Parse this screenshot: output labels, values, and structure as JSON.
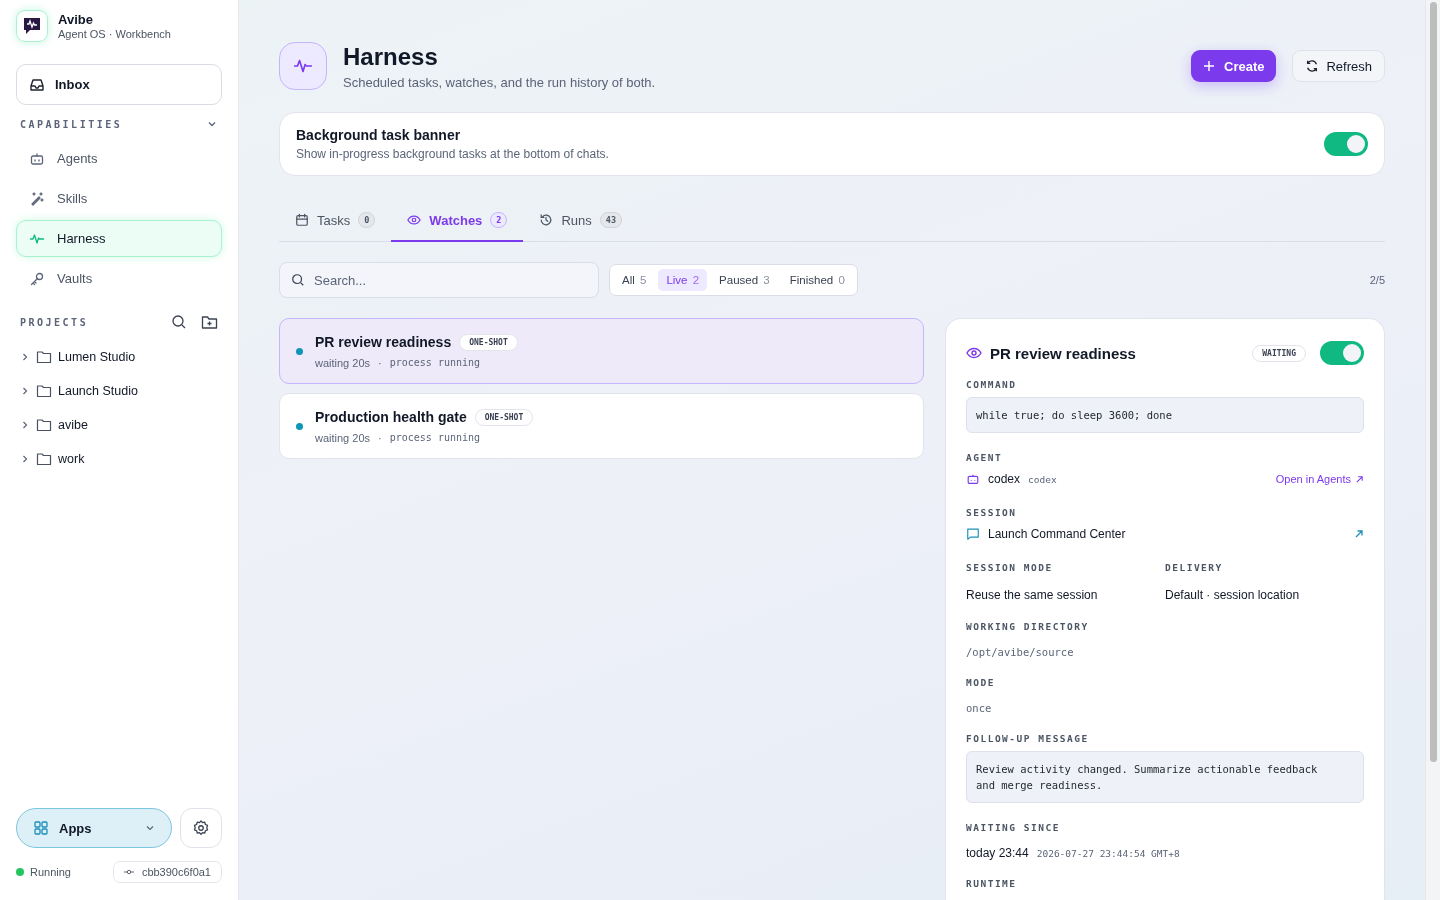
{
  "app": {
    "name": "Avibe",
    "subtitle": "Agent OS · Workbench"
  },
  "sidebar": {
    "inbox": {
      "label": "Inbox",
      "selected": false
    },
    "capabilities": {
      "label": "CAPABILITIES",
      "expanded": true,
      "items": [
        {
          "label": "Agents",
          "selected": false
        },
        {
          "label": "Skills",
          "selected": false
        },
        {
          "label": "Harness",
          "selected": true
        },
        {
          "label": "Vaults",
          "selected": false
        }
      ]
    },
    "projects": {
      "label": "PROJECTS",
      "items": [
        {
          "name": "Lumen Studio",
          "expanded": false
        },
        {
          "name": "Launch Studio",
          "expanded": false
        },
        {
          "name": "avibe",
          "expanded": false
        },
        {
          "name": "work",
          "expanded": false
        }
      ]
    },
    "apps_button": "Apps",
    "status": {
      "label": "Running",
      "color": "#22c55e"
    },
    "commit": "cbb390c6f0a1"
  },
  "header": {
    "title": "Harness",
    "subtitle": "Scheduled tasks, watches, and the run history of both.",
    "create": "Create",
    "refresh": "Refresh"
  },
  "banner": {
    "title": "Background task banner",
    "description": "Show in-progress background tasks at the bottom of chats.",
    "on": true
  },
  "tabs": [
    {
      "label": "Tasks",
      "count": "0",
      "selected": false
    },
    {
      "label": "Watches",
      "count": "2",
      "selected": true
    },
    {
      "label": "Runs",
      "count": "43",
      "selected": false
    }
  ],
  "search": {
    "placeholder": "Search..."
  },
  "filters": [
    {
      "label": "All",
      "count": "5",
      "selected": false
    },
    {
      "label": "Live",
      "count": "2",
      "selected": true
    },
    {
      "label": "Paused",
      "count": "3",
      "selected": false
    },
    {
      "label": "Finished",
      "count": "0",
      "selected": false
    }
  ],
  "pager": "2/5",
  "watches": [
    {
      "name": "PR review readiness",
      "badge": "ONE-SHOT",
      "status": "waiting 20s",
      "separator": "·",
      "detail": "process running",
      "selected": true
    },
    {
      "name": "Production health gate",
      "badge": "ONE-SHOT",
      "status": "waiting 20s",
      "separator": "·",
      "detail": "process running",
      "selected": false
    }
  ],
  "detail": {
    "title": "PR review readiness",
    "status": "WAITING",
    "on": true,
    "command_label": "COMMAND",
    "command": "while true; do sleep 3600; done",
    "agent_label": "AGENT",
    "agent_name": "codex",
    "agent_id": "codex",
    "agent_link": "Open in Agents",
    "session_label": "SESSION",
    "session_name": "Launch Command Center",
    "session_mode_label": "SESSION MODE",
    "session_mode": "Reuse the same session",
    "delivery_label": "DELIVERY",
    "delivery": "Default · session location",
    "workdir_label": "WORKING DIRECTORY",
    "workdir": "/opt/avibe/source",
    "mode_label": "MODE",
    "mode": "once",
    "followup_label": "FOLLOW-UP MESSAGE",
    "followup": "Review activity changed. Summarize actionable feedback and merge readiness.",
    "waiting_label": "WAITING SINCE",
    "waiting_since": "today 23:44",
    "waiting_stamp": "2026-07-27 23:44:54 GMT+8",
    "runtime_label": "RUNTIME"
  }
}
